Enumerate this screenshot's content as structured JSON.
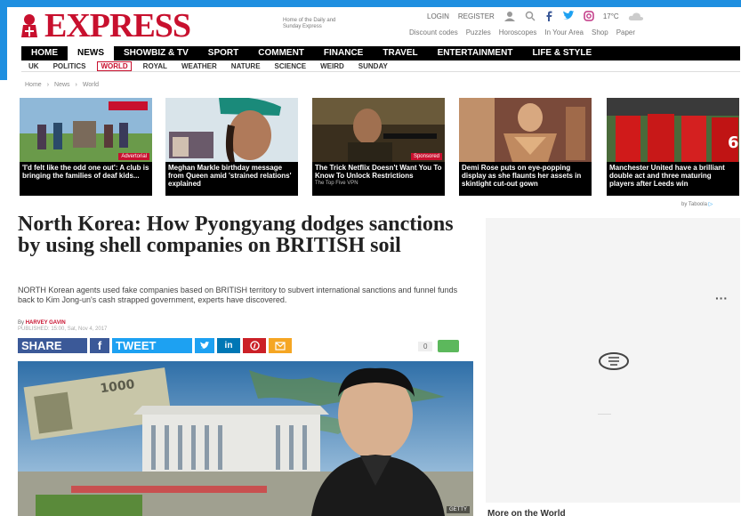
{
  "masthead": {
    "logo_text": "EXPRESS",
    "tagline": "Home of the Daily and Sunday Express",
    "login": "LOGIN",
    "register": "REGISTER",
    "temperature": "17°C",
    "util_links": [
      "Discount codes",
      "Puzzles",
      "Horoscopes",
      "In Your Area",
      "Shop",
      "Paper"
    ]
  },
  "nav": {
    "items": [
      "HOME",
      "NEWS",
      "SHOWBIZ & TV",
      "SPORT",
      "COMMENT",
      "FINANCE",
      "TRAVEL",
      "ENTERTAINMENT",
      "LIFE & STYLE"
    ],
    "active": "NEWS"
  },
  "subnav": {
    "items": [
      "UK",
      "POLITICS",
      "WORLD",
      "ROYAL",
      "WEATHER",
      "NATURE",
      "SCIENCE",
      "WEIRD",
      "SUNDAY"
    ],
    "active": "WORLD"
  },
  "breadcrumb": [
    "Home",
    "News",
    "World"
  ],
  "promos": [
    {
      "caption": "'I'd felt like the odd one out': A club is bringing the families of deaf kids...",
      "tag": "Advertorial",
      "sponsor": ""
    },
    {
      "caption": "Meghan Markle birthday message from Queen amid 'strained relations' explained",
      "tag": "",
      "sponsor": ""
    },
    {
      "caption": "The Trick Netflix Doesn't Want You To Know To Unlock Restrictions",
      "tag": "Sponsored",
      "sponsor": "The Top Five VPN"
    },
    {
      "caption": "Demi Rose puts on eye-popping display as she flaunts her assets in skintight cut-out gown",
      "tag": "",
      "sponsor": ""
    },
    {
      "caption": "Manchester United have a brilliant double act and three maturing players after Leeds win",
      "tag": "",
      "sponsor": ""
    }
  ],
  "taboola": "by Taboola",
  "article": {
    "headline": "North Korea: How Pyongyang dodges sanctions by using shell companies on BRITISH soil",
    "standfirst": "NORTH Korean agents used fake companies based on BRITISH territory to subvert international sanctions and funnel funds back to Kim Jong-un's cash strapped government, experts have discovered.",
    "byline_prefix": "By",
    "author": "HARVEY GAVIN",
    "published": "PUBLISHED: 15:00, Sat, Nov 4, 2017",
    "comment_count": "0",
    "image_credit": "GETTY"
  },
  "share": {
    "share_label": "SHARE",
    "tweet_label": "TWEET"
  },
  "sidebar": {
    "more_heading": "More on the World"
  },
  "colors": {
    "brand_red": "#c8102e",
    "facebook": "#3b5998",
    "twitter": "#1da1f2",
    "linkedin": "#0077b5",
    "pinterest": "#cb2027"
  }
}
